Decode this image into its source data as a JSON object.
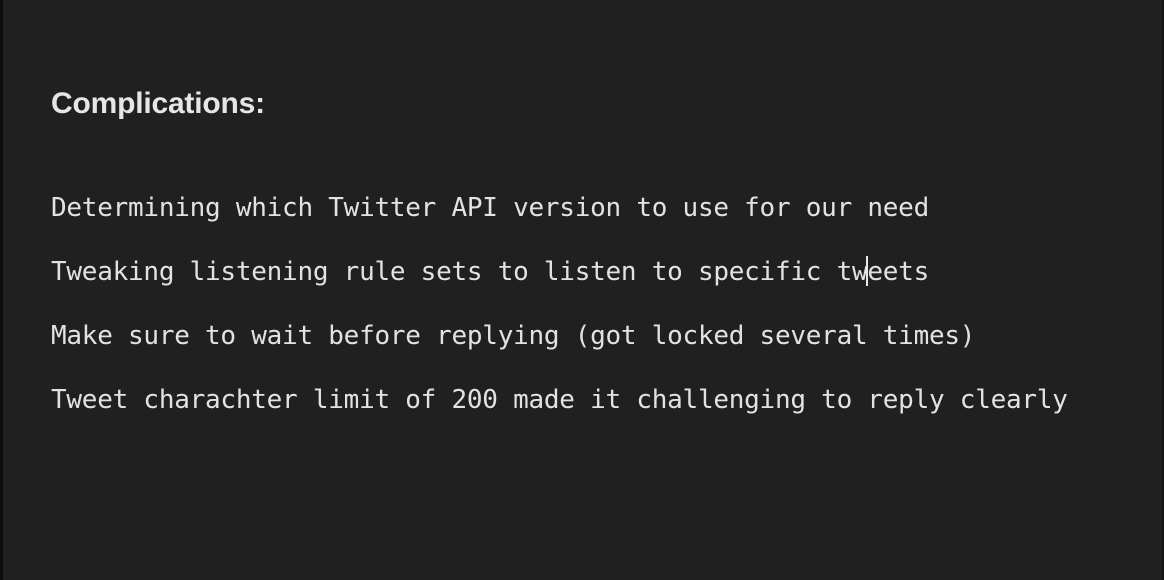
{
  "document": {
    "heading": "Complications:",
    "lines": [
      "Determining which Twitter API version to use for our need",
      "Tweaking listening rule sets to listen to specific tweets",
      "Make sure to wait before replying (got locked several times)",
      "Tweet charachter limit of 200 made it challenging to reply clearly"
    ],
    "caret_line_1_before": "Tweaking listening rule sets to listen to specific tw",
    "caret_line_1_after": "eets"
  },
  "colors": {
    "background": "#202020",
    "text": "#e2e2e2"
  }
}
